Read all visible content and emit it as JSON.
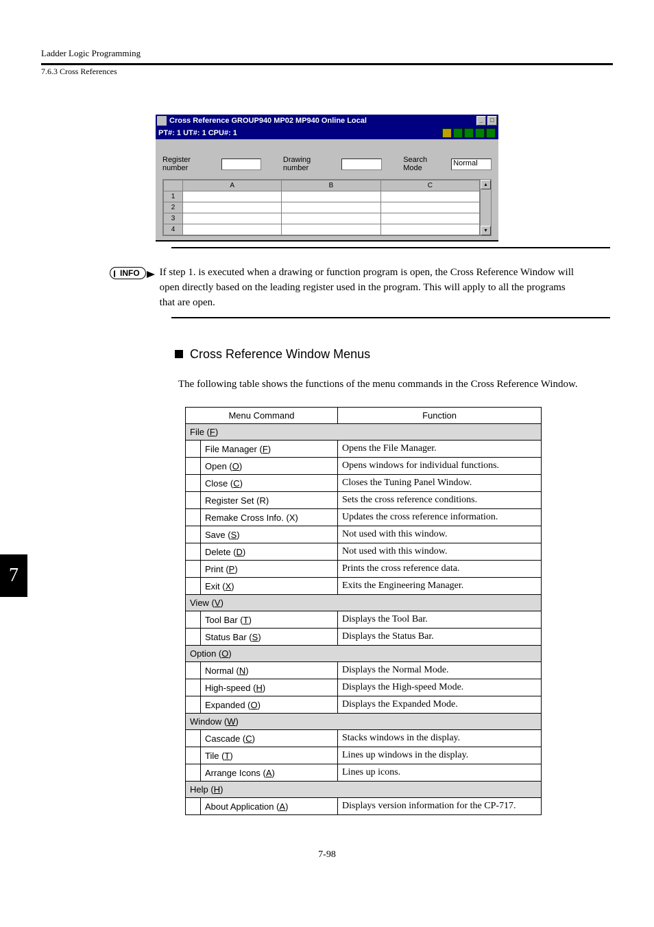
{
  "header": {
    "running": "Ladder Logic Programming",
    "sub": "7.6.3  Cross References"
  },
  "screenshot": {
    "title": "Cross Reference   GROUP940 MP02 MP940    Online  Local",
    "status": "PT#: 1 UT#: 1 CPU#: 1",
    "labels": {
      "register": "Register number",
      "drawing": "Drawing number",
      "searchmode": "Search Mode",
      "searchmode_value": "Normal"
    },
    "cols": [
      "",
      "A",
      "B",
      "C"
    ],
    "rows": [
      "1",
      "2",
      "3",
      "4"
    ]
  },
  "info": {
    "badge": "INFO",
    "text": "If step 1. is executed when a drawing or function program is open, the Cross Reference Window will open directly based on the leading register used in the program. This will apply to all the programs that are open."
  },
  "section": {
    "heading": "Cross Reference Window Menus",
    "lead": "The following table shows the functions of the menu commands in the Cross Reference Window."
  },
  "table": {
    "head": {
      "cmd": "Menu Command",
      "fn": "Function"
    },
    "groups": [
      {
        "label": "File (",
        "u": "F",
        "tail": ")",
        "items": [
          {
            "cmd_pre": "File Manager (",
            "u": "F",
            "cmd_post": ")",
            "fn": "Opens the File Manager."
          },
          {
            "cmd_pre": "Open (",
            "u": "O",
            "cmd_post": ")",
            "fn": "Opens windows for individual functions."
          },
          {
            "cmd_pre": "Close (",
            "u": "C",
            "cmd_post": ")",
            "fn": "Closes the Tuning Panel Window."
          },
          {
            "cmd_pre": "Register Set (R)",
            "u": "",
            "cmd_post": "",
            "fn": "Sets the cross reference conditions."
          },
          {
            "cmd_pre": "Remake Cross Info. (X)",
            "u": "",
            "cmd_post": "",
            "fn": "Updates the cross reference information."
          },
          {
            "cmd_pre": "Save (",
            "u": "S",
            "cmd_post": ")",
            "fn": "Not used with this window."
          },
          {
            "cmd_pre": "Delete (",
            "u": "D",
            "cmd_post": ")",
            "fn": "Not used with this window."
          },
          {
            "cmd_pre": "Print (",
            "u": "P",
            "cmd_post": ")",
            "fn": "Prints the cross reference data."
          },
          {
            "cmd_pre": "Exit (",
            "u": "X",
            "cmd_post": ")",
            "fn": "Exits the Engineering Manager."
          }
        ]
      },
      {
        "label": "View (",
        "u": "V",
        "tail": ")",
        "items": [
          {
            "cmd_pre": "Tool Bar (",
            "u": "T",
            "cmd_post": ")",
            "fn": "Displays the Tool Bar."
          },
          {
            "cmd_pre": "Status Bar (",
            "u": "S",
            "cmd_post": ")",
            "fn": "Displays the Status Bar."
          }
        ]
      },
      {
        "label": "Option (",
        "u": "O",
        "tail": ")",
        "items": [
          {
            "cmd_pre": "Normal (",
            "u": "N",
            "cmd_post": ")",
            "fn": "Displays the Normal Mode."
          },
          {
            "cmd_pre": "High-speed (",
            "u": "H",
            "cmd_post": ")",
            "fn": "Displays the High-speed Mode."
          },
          {
            "cmd_pre": "Expanded (",
            "u": "O",
            "cmd_post": ")",
            "fn": "Displays the Expanded Mode."
          }
        ]
      },
      {
        "label": "Window (",
        "u": "W",
        "tail": ")",
        "items": [
          {
            "cmd_pre": "Cascade (",
            "u": "C",
            "cmd_post": ")",
            "fn": "Stacks windows in the display."
          },
          {
            "cmd_pre": "Tile (",
            "u": "T",
            "cmd_post": ")",
            "fn": "Lines up windows in the display."
          },
          {
            "cmd_pre": "Arrange Icons (",
            "u": "A",
            "cmd_post": ")",
            "fn": "Lines up icons."
          }
        ]
      },
      {
        "label": "Help (",
        "u": "H",
        "tail": ")",
        "items": [
          {
            "cmd_pre": "About Application (",
            "u": "A",
            "cmd_post": ")",
            "fn": "Displays version information for the CP-717."
          }
        ]
      }
    ]
  },
  "sidetab": "7",
  "page_num": "7-98"
}
